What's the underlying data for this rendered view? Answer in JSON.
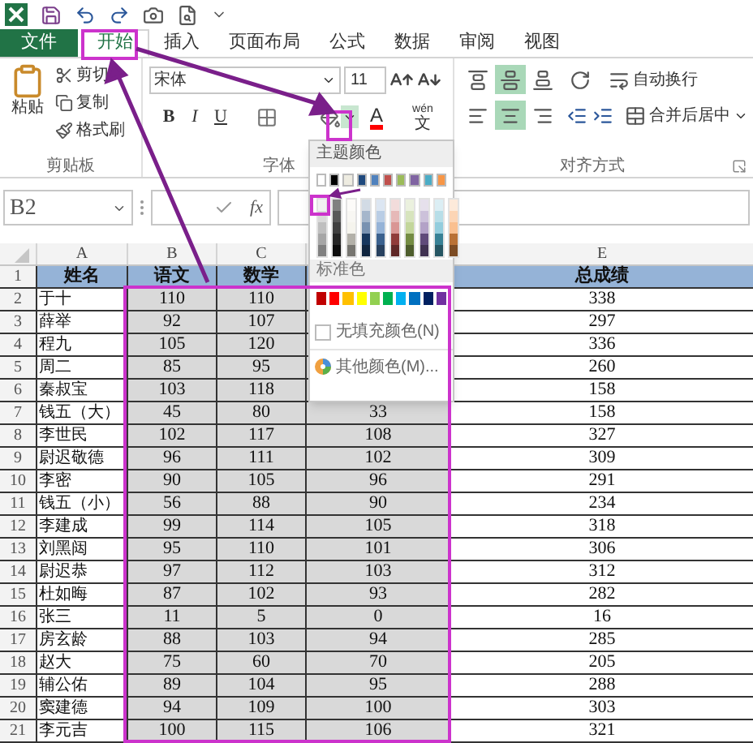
{
  "tabs": [
    {
      "label": "文件",
      "kind": "file",
      "selected": false
    },
    {
      "label": "开始",
      "kind": "tab",
      "selected": true
    },
    {
      "label": "插入",
      "kind": "tab",
      "selected": false
    },
    {
      "label": "页面布局",
      "kind": "tab",
      "selected": false
    },
    {
      "label": "公式",
      "kind": "tab",
      "selected": false
    },
    {
      "label": "数据",
      "kind": "tab",
      "selected": false
    },
    {
      "label": "审阅",
      "kind": "tab",
      "selected": false
    },
    {
      "label": "视图",
      "kind": "tab",
      "selected": false
    }
  ],
  "ribbon": {
    "clipboard": {
      "paste": "粘贴",
      "items": [
        {
          "kind": "cut",
          "label": "剪切"
        },
        {
          "kind": "copy",
          "label": "复制"
        },
        {
          "kind": "format",
          "label": "格式刷"
        }
      ],
      "label": "剪贴板"
    },
    "font": {
      "name": "宋体",
      "size": "11",
      "styles": [
        "B",
        "I",
        "U"
      ],
      "color_letter": "A",
      "phonetic": {
        "ruby": "wén",
        "char": "文"
      },
      "label": "字体"
    },
    "alignment": {
      "vertical": [
        {
          "kind": "top",
          "selected": false
        },
        {
          "kind": "middle",
          "selected": true
        },
        {
          "kind": "bottom",
          "selected": false
        }
      ],
      "horizontal": [
        {
          "kind": "left",
          "selected": false
        },
        {
          "kind": "center",
          "selected": true
        },
        {
          "kind": "right",
          "selected": false
        }
      ],
      "wrap": "自动换行",
      "merge": "合并后居中",
      "label": "对齐方式"
    }
  },
  "formula_bar": {
    "name_box": "B2",
    "fx": "fx"
  },
  "sheet": {
    "columns": [
      {
        "letter": "A",
        "heading": "姓名",
        "selected": false
      },
      {
        "letter": "B",
        "heading": "语文",
        "selected": true
      },
      {
        "letter": "C",
        "heading": "数学",
        "selected": true
      },
      {
        "selected": true
      },
      {
        "letter": "E",
        "heading": "总成绩",
        "selected": false
      }
    ],
    "rows": [
      {
        "number": "2",
        "cells": [
          "于十",
          "110",
          "110",
          null,
          "338"
        ]
      },
      {
        "number": "3",
        "cells": [
          "薛举",
          "92",
          "107",
          null,
          "297"
        ]
      },
      {
        "number": "4",
        "cells": [
          "程九",
          "105",
          "120",
          null,
          "336"
        ]
      },
      {
        "number": "5",
        "cells": [
          "周二",
          "85",
          "95",
          null,
          "260"
        ]
      },
      {
        "number": "6",
        "cells": [
          "秦叔宝",
          "103",
          "118",
          null,
          "158"
        ]
      },
      {
        "number": "7",
        "cells": [
          "钱五（大）",
          "45",
          "80",
          "33",
          "158"
        ]
      },
      {
        "number": "8",
        "cells": [
          "李世民",
          "102",
          "117",
          "108",
          "327"
        ]
      },
      {
        "number": "9",
        "cells": [
          "尉迟敬德",
          "96",
          "111",
          "102",
          "309"
        ]
      },
      {
        "number": "10",
        "cells": [
          "李密",
          "90",
          "105",
          "96",
          "291"
        ]
      },
      {
        "number": "11",
        "cells": [
          "钱五（小）",
          "56",
          "88",
          "90",
          "234"
        ]
      },
      {
        "number": "12",
        "cells": [
          "李建成",
          "99",
          "114",
          "105",
          "318"
        ]
      },
      {
        "number": "13",
        "cells": [
          "刘黑闼",
          "95",
          "110",
          "101",
          "306"
        ]
      },
      {
        "number": "14",
        "cells": [
          "尉迟恭",
          "97",
          "112",
          "103",
          "312"
        ]
      },
      {
        "number": "15",
        "cells": [
          "杜如晦",
          "87",
          "102",
          "93",
          "282"
        ]
      },
      {
        "number": "16",
        "cells": [
          "张三",
          "11",
          "5",
          "0",
          "16"
        ]
      },
      {
        "number": "17",
        "cells": [
          "房玄龄",
          "88",
          "103",
          "94",
          "285"
        ]
      },
      {
        "number": "18",
        "cells": [
          "赵大",
          "75",
          "60",
          "70",
          "205"
        ]
      },
      {
        "number": "19",
        "cells": [
          "辅公佑",
          "89",
          "104",
          "95",
          "288"
        ]
      },
      {
        "number": "20",
        "cells": [
          "窦建德",
          "94",
          "109",
          "100",
          "303"
        ]
      },
      {
        "number": "21",
        "cells": [
          "李元吉",
          "100",
          "115",
          "106",
          "321"
        ]
      }
    ],
    "header_row_number": "1"
  },
  "color_menu": {
    "title": "主题颜色",
    "theme_colors": [
      {
        "color": "#ffffff"
      },
      {
        "color": "#000000"
      },
      {
        "color": "#eeece1"
      },
      {
        "color": "#1f497d"
      },
      {
        "color": "#4f81bd"
      },
      {
        "color": "#c0504d"
      },
      {
        "color": "#9bbb59"
      },
      {
        "color": "#8064a2"
      },
      {
        "color": "#4bacc6"
      },
      {
        "color": "#f79646"
      }
    ],
    "standard_title": "标准色",
    "standard_colors": [
      {
        "color": "#c00000"
      },
      {
        "color": "#ff0000"
      },
      {
        "color": "#ffc000"
      },
      {
        "color": "#ffff00"
      },
      {
        "color": "#92d050"
      },
      {
        "color": "#00b050"
      },
      {
        "color": "#00b0f0"
      },
      {
        "color": "#0070c0"
      },
      {
        "color": "#002060"
      },
      {
        "color": "#7030a0"
      }
    ],
    "no_fill": "无填充颜色(N)",
    "more": "其他颜色(M)..."
  }
}
